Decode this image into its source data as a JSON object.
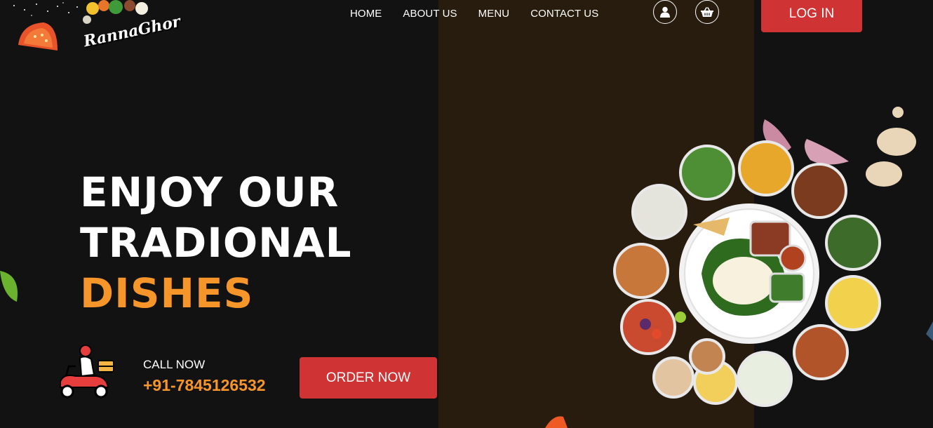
{
  "brand": {
    "logo_text": "RannaGhor"
  },
  "nav": {
    "items": [
      {
        "label": "HOME"
      },
      {
        "label": "ABOUT US"
      },
      {
        "label": "MENU"
      },
      {
        "label": "CONTACT US"
      }
    ],
    "icons": [
      "user-icon",
      "basket-icon"
    ],
    "login_label": "LOG IN"
  },
  "hero": {
    "line1": "ENJOY OUR",
    "line2": "TRADIONAL",
    "line3": "DISHES"
  },
  "call": {
    "label": "CALL NOW",
    "number": "+91-7845126532"
  },
  "order_label": "ORDER NOW",
  "colors": {
    "background": "#121213",
    "panel": "#271c0d",
    "accent": "#f6962a",
    "button": "#d03333"
  }
}
